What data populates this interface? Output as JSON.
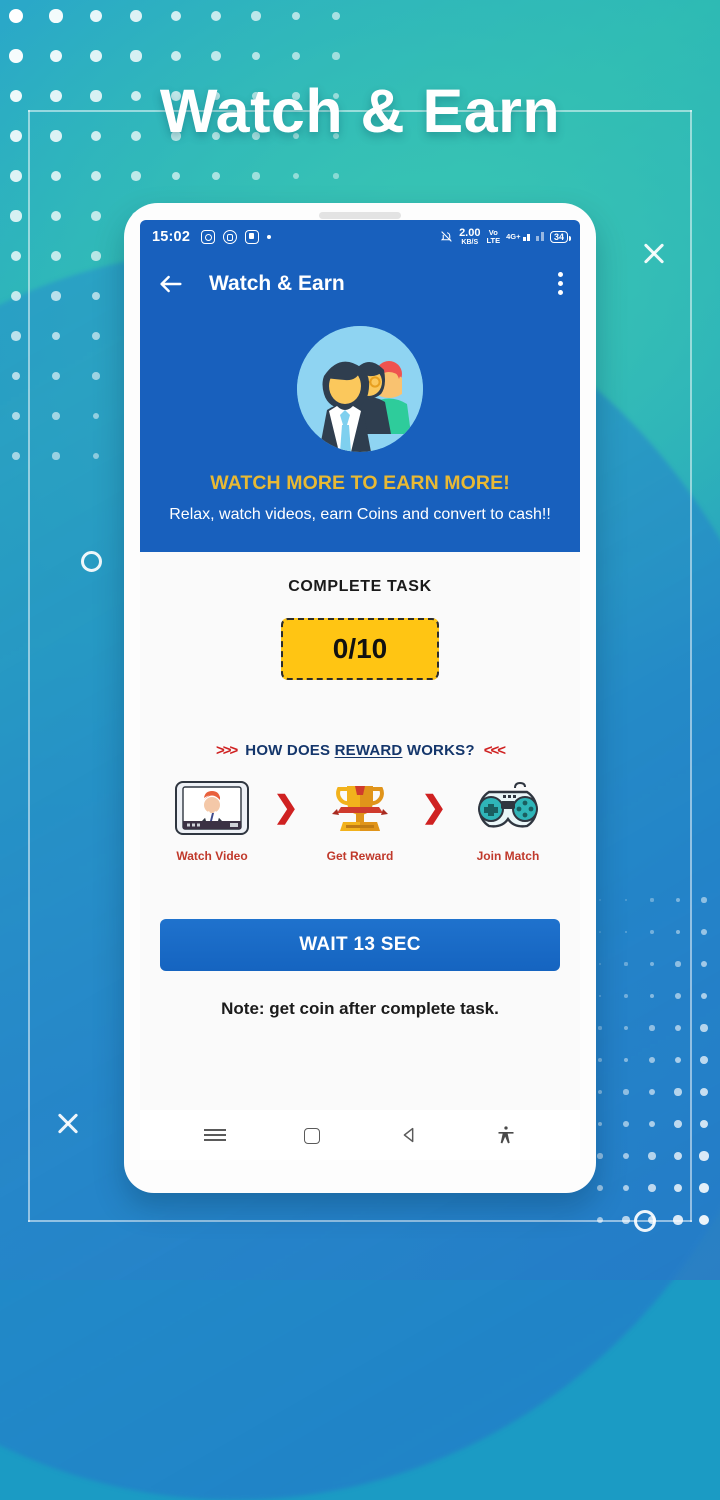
{
  "promo": {
    "title": "Watch & Earn",
    "accent_teal": "#2bb8b4",
    "accent_blue": "#2a7fc4"
  },
  "phone": {
    "status_bar": {
      "clock": "15:02",
      "left_icons": [
        "instagram-icon",
        "app-round-icon",
        "app-square-icon",
        "notification-dot"
      ],
      "bell": "bell-muted-icon",
      "data_speed_value": "2.00",
      "data_speed_unit": "KB/S",
      "volte_top": "Vo",
      "volte_bottom": "LTE",
      "network": "4G+",
      "battery_level": "34"
    },
    "app_bar": {
      "back": "back-arrow-icon",
      "title": "Watch & Earn",
      "overflow": "kebab-menu-icon"
    },
    "hero": {
      "avatar": "people-group-illustration",
      "headline": "WATCH MORE TO EARN MORE!",
      "subtext": "Relax, watch videos, earn Coins and convert to cash!!",
      "headline_color": "#e8b934",
      "background_color": "#1860bd"
    },
    "task": {
      "label": "COMPLETE TASK",
      "counter": "0/10",
      "badge_color": "#ffc513"
    },
    "reward_section": {
      "chevrons_left": ">>>",
      "chevrons_right": "<<<",
      "heading_prefix": "HOW DOES ",
      "heading_underlined": "REWARD",
      "heading_suffix": " WORKS?",
      "steps": [
        {
          "icon": "tablet-video-icon",
          "label": "Watch Video"
        },
        {
          "icon": "trophy-icon",
          "label": "Get Reward"
        },
        {
          "icon": "gamepad-icon",
          "label": "Join Match"
        }
      ],
      "arrow": "❯"
    },
    "cta": {
      "button_label": "WAIT 13 SEC",
      "button_color": "#1564c0"
    },
    "note": "Note: get coin after complete task.",
    "nav_bar": {
      "items": [
        "recents-menu-icon",
        "home-icon",
        "back-icon",
        "accessibility-icon"
      ]
    }
  }
}
